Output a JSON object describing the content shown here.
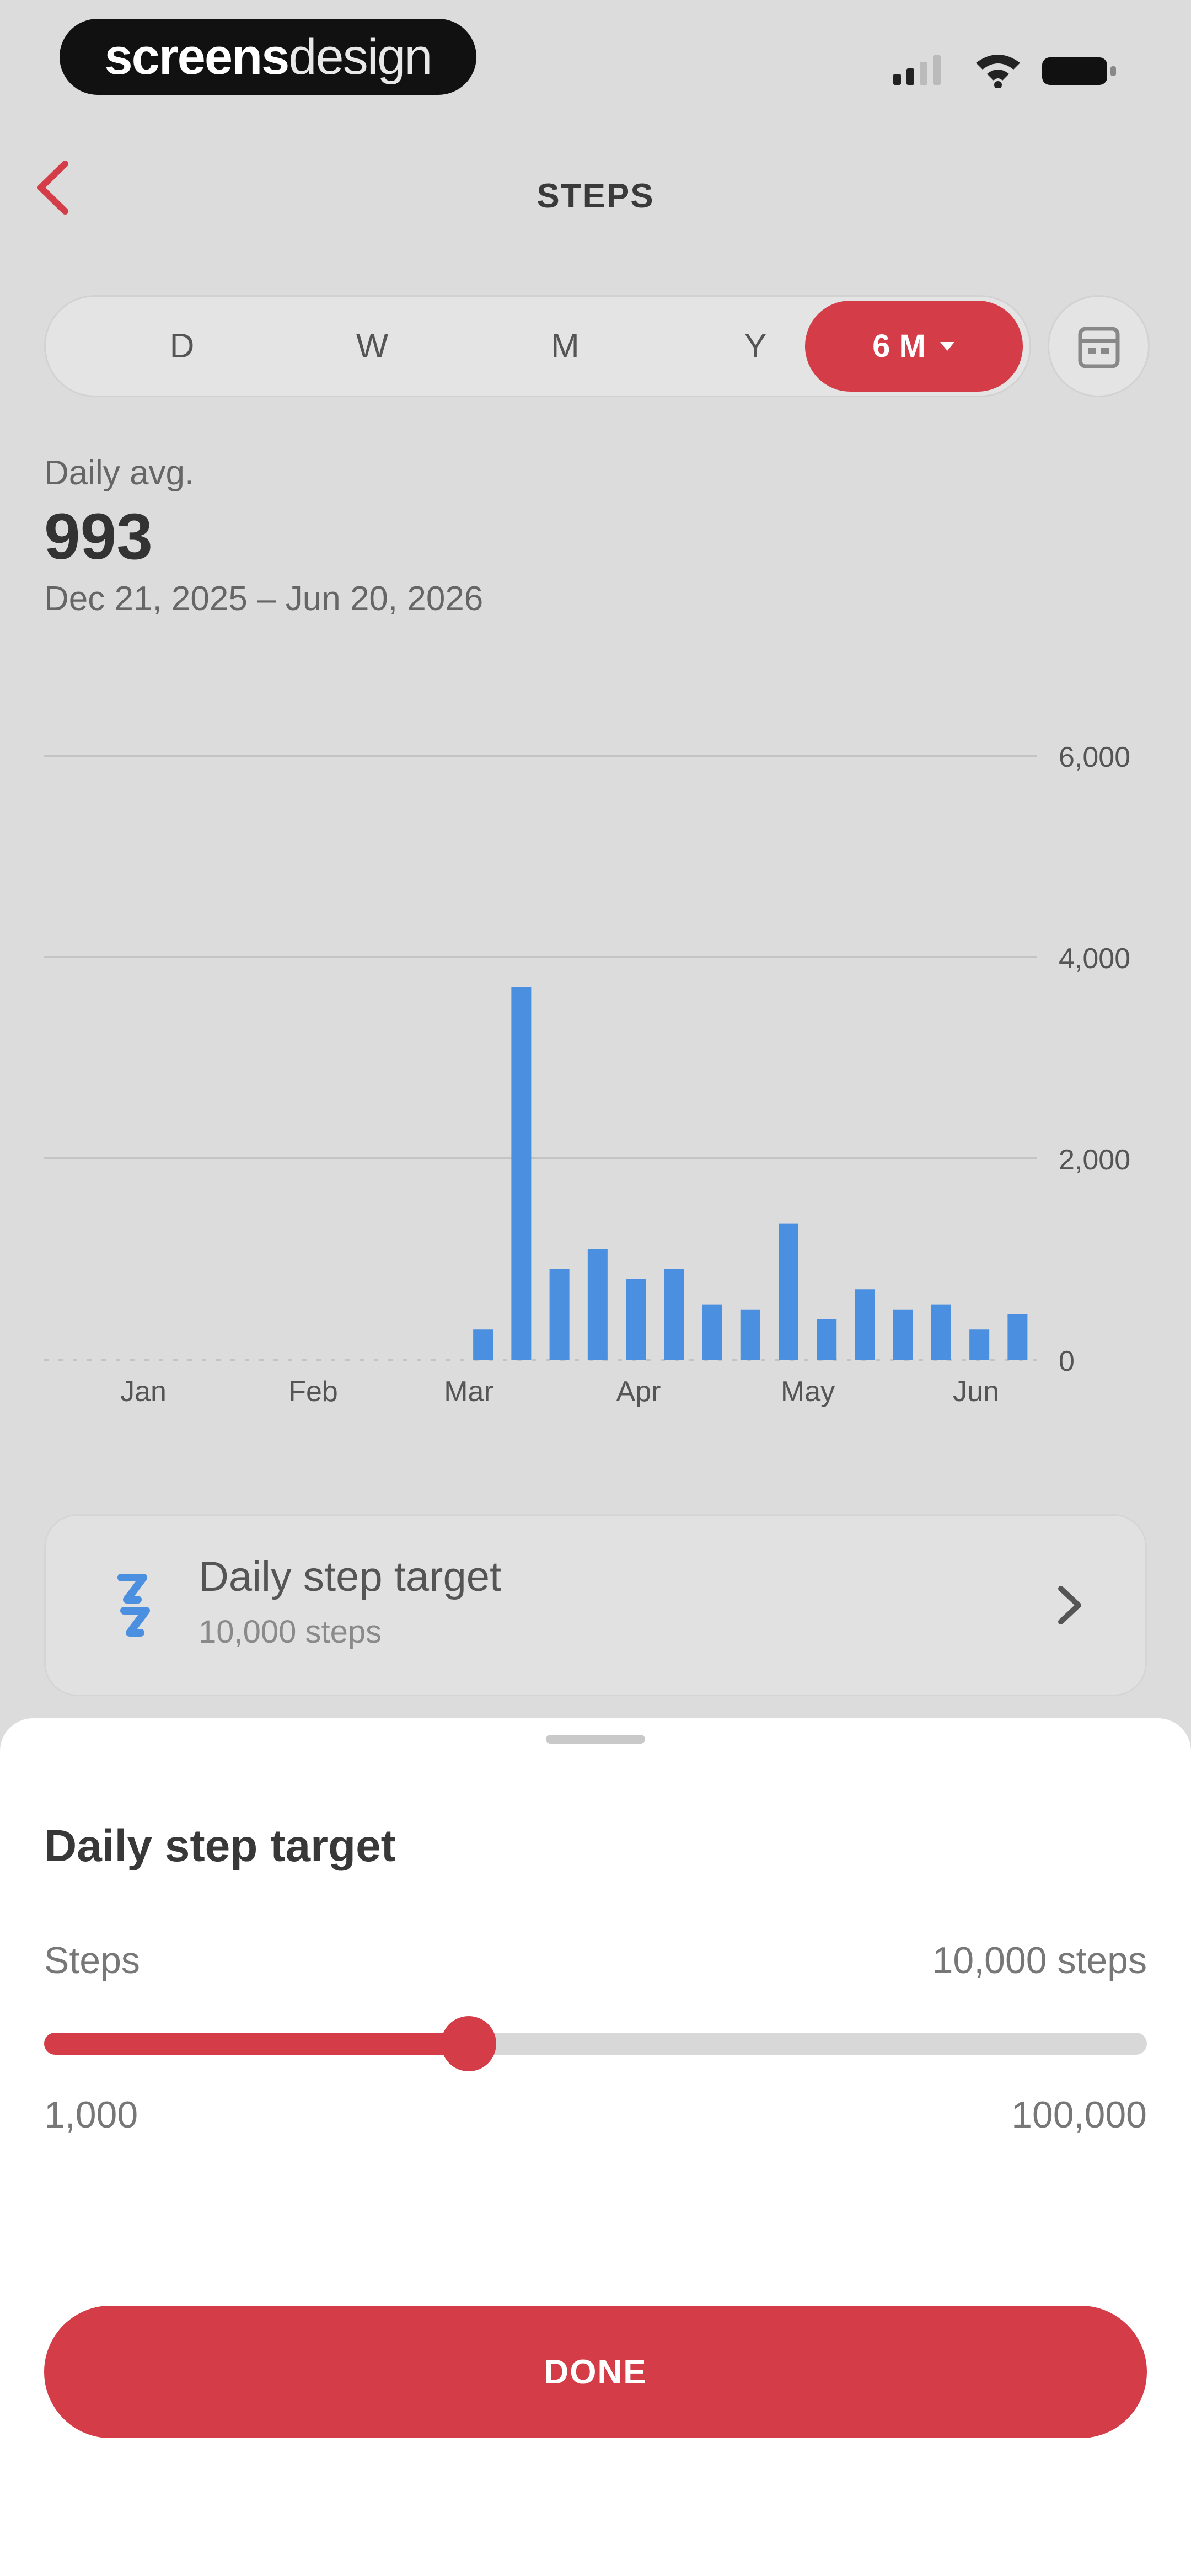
{
  "status_bar": {
    "brand_bold": "screens",
    "brand_light": "design",
    "icons": [
      "signal-icon",
      "wifi-icon",
      "battery-icon"
    ]
  },
  "header": {
    "back_icon": "chevron-left-icon",
    "title": "STEPS"
  },
  "range_tabs": {
    "items": [
      "D",
      "W",
      "M",
      "Y"
    ],
    "active": "6 M",
    "active_icon": "caret-down-icon"
  },
  "summary": {
    "label": "Daily avg.",
    "value": "993",
    "range": "Dec 21, 2025 – Jun 20, 2026"
  },
  "chart_data": {
    "type": "bar",
    "y_ticks": [
      "6,000",
      "4,000",
      "2,000",
      "0"
    ],
    "ylim": [
      0,
      6000
    ],
    "x_labels": [
      "Jan",
      "Feb",
      "Mar",
      "Apr",
      "May",
      "Jun"
    ],
    "values": [
      0,
      0,
      0,
      0,
      0,
      0,
      0,
      0,
      0,
      0,
      0,
      300,
      3700,
      900,
      1100,
      800,
      900,
      550,
      500,
      1350,
      400,
      700,
      500,
      550,
      300,
      450
    ],
    "grid": true,
    "bar_color": "#4a8fe0"
  },
  "target_card": {
    "icon": "steps-icon",
    "title": "Daily step target",
    "subtitle": "10,000 steps",
    "chevron_icon": "chevron-right-icon"
  },
  "sheet": {
    "title": "Daily step target",
    "steps_label": "Steps",
    "steps_value": "10,000 steps",
    "slider_fraction": 0.385,
    "min_label": "1,000",
    "max_label": "100,000",
    "done_label": "DONE"
  },
  "colors": {
    "accent": "#d43d47",
    "bar": "#4a8fe0"
  }
}
